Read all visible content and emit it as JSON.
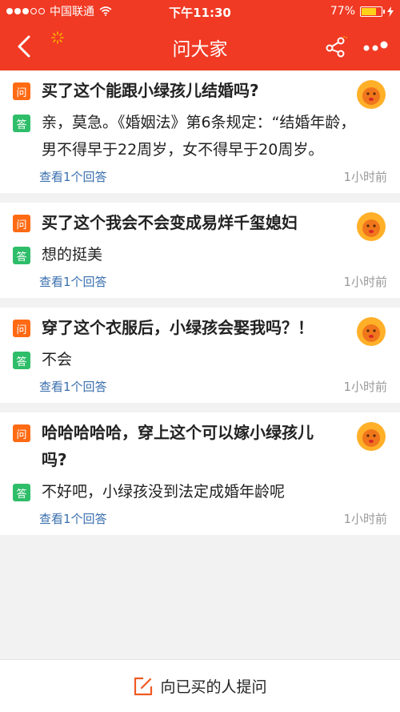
{
  "status_bar": {
    "carrier": "中国联通",
    "time": "下午11:30",
    "battery": "77%",
    "battery_level": 0.77,
    "battery_color": "#ffd21a"
  },
  "header": {
    "title": "问大家",
    "background": "#f03a24",
    "icons": [
      "back-arrow-icon",
      "spinner-icon",
      "share-icon",
      "more-icon"
    ]
  },
  "badges": {
    "question": "问",
    "answer": "答",
    "question_color": "#ff6a13",
    "answer_color": "#2ebd69"
  },
  "questions": [
    {
      "question": "买了这个能跟小绿孩儿结婚吗?",
      "answer": "亲，莫急。《婚姻法》第6条规定：“结婚年龄，男不得早于22周岁，女不得早于20周岁。",
      "view_answers": "查看1个回答",
      "time": "1小时前"
    },
    {
      "question": "买了这个我会不会变成易烊千玺媳妇",
      "answer": "想的挺美",
      "view_answers": "查看1个回答",
      "time": "1小时前"
    },
    {
      "question": "穿了这个衣服后，小绿孩会娶我吗？！",
      "answer": "不会",
      "view_answers": "查看1个回答",
      "time": "1小时前"
    },
    {
      "question": "哈哈哈哈哈，穿上这个可以嫁小绿孩儿吗?",
      "answer": "不好吧，小绿孩没到法定成婚年龄呢",
      "view_answers": "查看1个回答",
      "time": "1小时前"
    }
  ],
  "bottom_bar": {
    "ask_label": "向已买的人提问",
    "icon": "edit-icon"
  }
}
